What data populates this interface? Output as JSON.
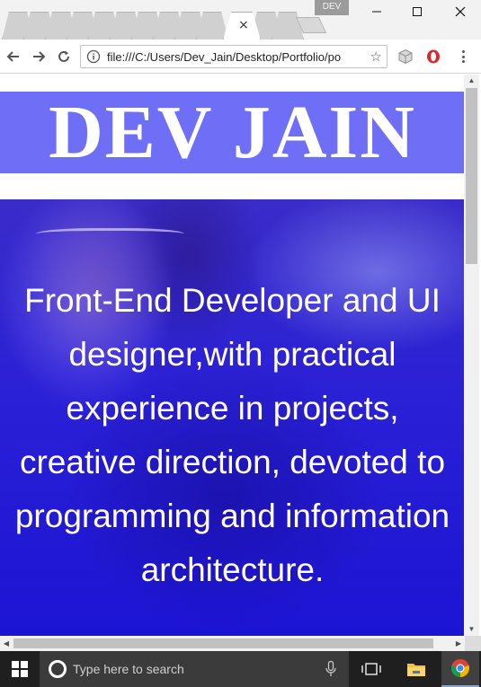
{
  "browser": {
    "profile_label": "DEV",
    "address_url": "file:///C:/Users/Dev_Jain/Desktop/Portfolio/po",
    "active_tab_close": "×",
    "bookmark_star": "☆"
  },
  "page": {
    "header_title": "DEV JAIN",
    "hero_text": "Front-End Developer and UI designer,with practical experience in projects, creative direction, devoted to programming and information architecture."
  },
  "taskbar": {
    "search_placeholder": "Type here to search"
  },
  "colors": {
    "header_bg": "#6e6ef7",
    "hero_overlay": "#2a20d6",
    "taskbar_bg": "#1f1f1f"
  }
}
